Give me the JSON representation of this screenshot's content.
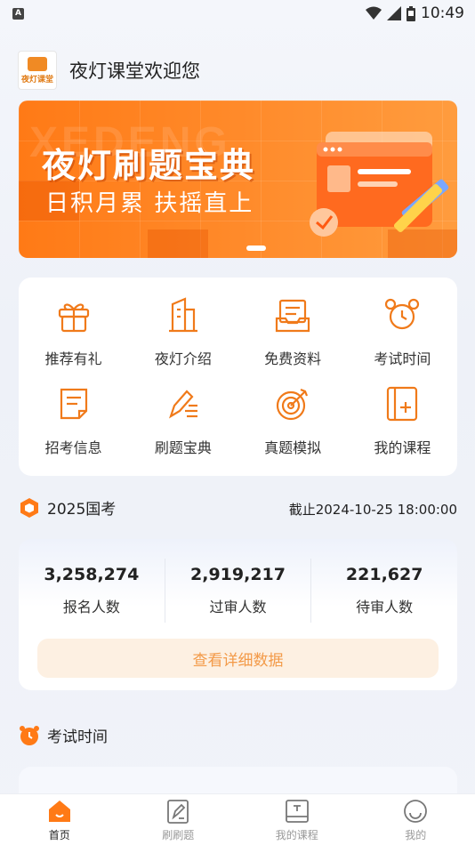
{
  "status_bar": {
    "time": "10:49",
    "left_badge": "A"
  },
  "header": {
    "logo_text": "夜灯课堂",
    "title": "夜灯课堂欢迎您"
  },
  "banner": {
    "watermark": "XEDENG",
    "title": "夜灯刷题宝典",
    "subtitle": "日积月累 扶摇直上"
  },
  "menu": {
    "items": [
      {
        "label": "推荐有礼",
        "icon": "gift-icon"
      },
      {
        "label": "夜灯介绍",
        "icon": "building-icon"
      },
      {
        "label": "免费资料",
        "icon": "inbox-icon"
      },
      {
        "label": "考试时间",
        "icon": "alarm-clock-icon"
      },
      {
        "label": "招考信息",
        "icon": "notice-icon"
      },
      {
        "label": "刷题宝典",
        "icon": "pen-list-icon"
      },
      {
        "label": "真题模拟",
        "icon": "target-icon"
      },
      {
        "label": "我的课程",
        "icon": "course-book-icon"
      }
    ]
  },
  "exam_section": {
    "title": "2025国考",
    "deadline": "截止2024-10-25 18:00:00",
    "stats": [
      {
        "value": "3,258,274",
        "label": "报名人数"
      },
      {
        "value": "2,919,217",
        "label": "过审人数"
      },
      {
        "value": "221,627",
        "label": "待审人数"
      }
    ],
    "detail_button": "查看详细数据"
  },
  "exam_time_section": {
    "title": "考试时间"
  },
  "tabs": [
    {
      "label": "首页",
      "icon": "home-icon",
      "active": true
    },
    {
      "label": "刷刷题",
      "icon": "practice-icon",
      "active": false
    },
    {
      "label": "我的课程",
      "icon": "course-icon",
      "active": false
    },
    {
      "label": "我的",
      "icon": "profile-icon",
      "active": false
    }
  ],
  "colors": {
    "accent": "#ff7a16",
    "banner": "#ff8a2a",
    "button_bg": "#fdf0e2",
    "button_text": "#f39a48"
  }
}
